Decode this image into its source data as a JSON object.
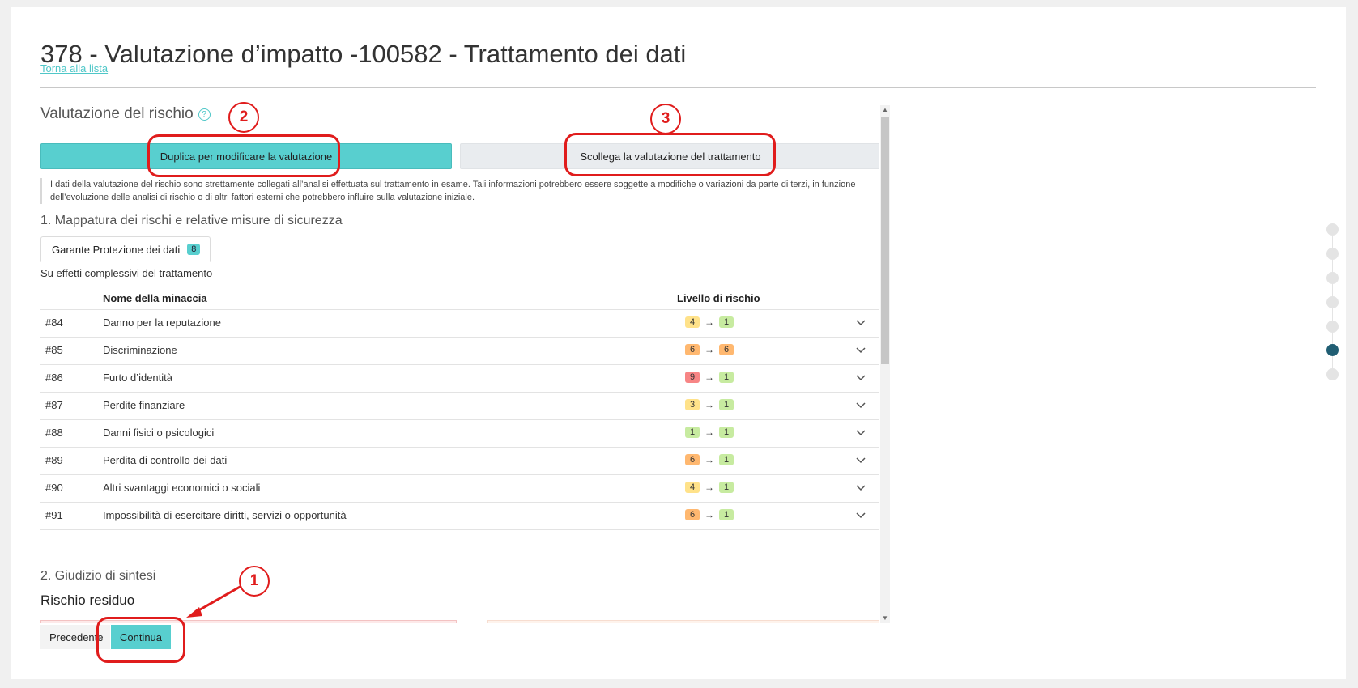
{
  "page": {
    "title": "378 - Valutazione d’impatto -100582 - Trattamento dei dati",
    "back_link": "Torna alla lista"
  },
  "risk": {
    "section_title": "Valutazione del rischio",
    "help_icon": "?",
    "duplicate_button": "Duplica per modificare la valutazione",
    "unlink_button": "Scollega la valutazione del trattamento",
    "note": "I dati della valutazione del rischio sono strettamente collegati all’analisi effettuata sul trattamento in esame. Tali informazioni potrebbero essere soggette a modifiche o variazioni da parte di terzi, in funzione dell’evoluzione delle analisi di rischio o di altri fattori esterni che potrebbero influire sulla valutazione iniziale.",
    "mapping_title": "1. Mappatura dei rischi e relative misure di sicurezza",
    "tab": {
      "label": "Garante Protezione dei dati",
      "count": "8"
    },
    "context_label": "Su effetti complessivi del trattamento",
    "columns": {
      "name": "Nome della minaccia",
      "level": "Livello di rischio"
    },
    "threats": [
      {
        "id": "#84",
        "name": "Danno per la reputazione",
        "from": "4",
        "to": "1",
        "from_class": "lvl-yellow",
        "to_class": "lvl-green"
      },
      {
        "id": "#85",
        "name": "Discriminazione",
        "from": "6",
        "to": "6",
        "from_class": "lvl-orange",
        "to_class": "lvl-orange"
      },
      {
        "id": "#86",
        "name": "Furto d’identità",
        "from": "9",
        "to": "1",
        "from_class": "lvl-red",
        "to_class": "lvl-green"
      },
      {
        "id": "#87",
        "name": "Perdite finanziare",
        "from": "3",
        "to": "1",
        "from_class": "lvl-yellow",
        "to_class": "lvl-green"
      },
      {
        "id": "#88",
        "name": "Danni fisici o psicologici",
        "from": "1",
        "to": "1",
        "from_class": "lvl-green",
        "to_class": "lvl-green"
      },
      {
        "id": "#89",
        "name": "Perdita di controllo dei dati",
        "from": "6",
        "to": "1",
        "from_class": "lvl-orange",
        "to_class": "lvl-green"
      },
      {
        "id": "#90",
        "name": "Altri svantaggi economici o sociali",
        "from": "4",
        "to": "1",
        "from_class": "lvl-yellow",
        "to_class": "lvl-green"
      },
      {
        "id": "#91",
        "name": "Impossibilità di esercitare diritti, servizi o opportunità",
        "from": "6",
        "to": "1",
        "from_class": "lvl-orange",
        "to_class": "lvl-green"
      }
    ],
    "arrow": "→",
    "summary_title": "2. Giudizio di sintesi",
    "residual_title": "Rischio residuo"
  },
  "footer": {
    "prev_button": "Precedente",
    "next_button": "Continua"
  },
  "stepper": {
    "steps": 7,
    "active_step": 6
  },
  "annotations": {
    "marker_1": "1",
    "marker_2": "2",
    "marker_3": "3",
    "color": "#e01c1c"
  },
  "colors": {
    "accent": "#58cfcf",
    "link": "#4fc7c8",
    "stepper_active": "#205e73"
  }
}
